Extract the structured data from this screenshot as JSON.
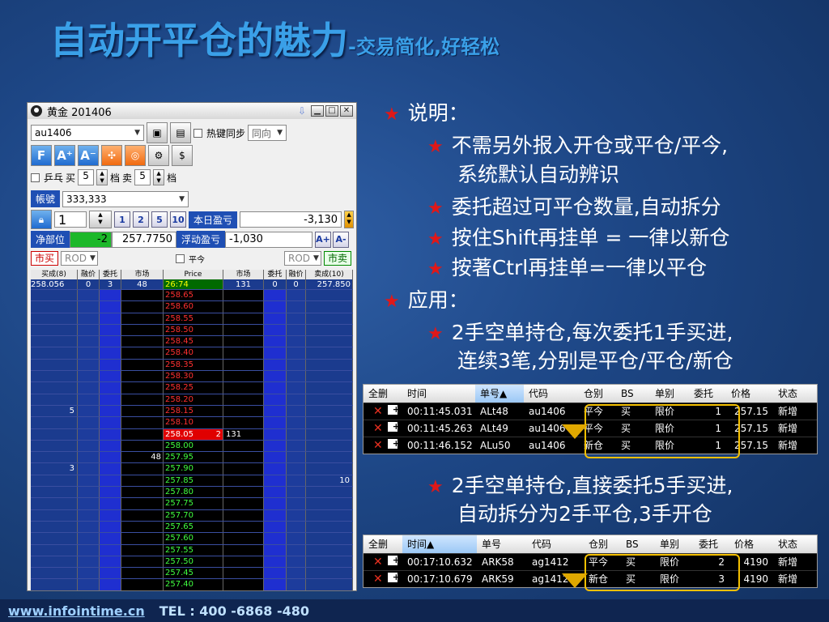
{
  "slide": {
    "title": "自动开平仓的魅力",
    "subtitle": "-交易简化,好轻松"
  },
  "window": {
    "title": "黄金 201406",
    "symbol": "au1406",
    "hotkey_sync_label": "热键同步",
    "direction": "同向",
    "icons": [
      "F",
      "A⁺",
      "A⁻"
    ],
    "pingpong_label": "乒乓",
    "buy_label": "买",
    "buy_ticks": "5",
    "tick_label": "档",
    "sell_label": "卖",
    "sell_ticks": "5",
    "tick_label2": "档",
    "account_label": "帳號",
    "account_value": "333,333",
    "qty": "1",
    "qty_buttons": [
      "1",
      "2",
      "5",
      "10"
    ],
    "today_pnl_label": "本日盈亏",
    "today_pnl_value": "-3,130",
    "net_position_label": "净部位",
    "net_position_value": "-2",
    "avg_price": "257.7750",
    "float_pnl_label": "浮动盈亏",
    "float_pnl_value": "-1,030",
    "font_plus": "A+",
    "font_minus": "A-",
    "market_buy": "市买",
    "rod_left": "ROD",
    "close_today_label": "平今",
    "rod_right": "ROD",
    "market_sell": "市卖"
  },
  "ladder": {
    "headers": [
      "买成(8)",
      "融价",
      "委托",
      "市场",
      "Price",
      "市场",
      "委托",
      "融价",
      "卖成(10)"
    ],
    "first_row": [
      "258.056",
      "0",
      "3",
      "48",
      "26:74",
      "131",
      "0",
      "0",
      "257.850"
    ],
    "rows": [
      {
        "l": "",
        "p": "258.65",
        "r": "",
        "cls": "up"
      },
      {
        "l": "",
        "p": "258.60",
        "r": "",
        "cls": "up"
      },
      {
        "l": "",
        "p": "258.55",
        "r": "",
        "cls": "up"
      },
      {
        "l": "",
        "p": "258.50",
        "r": "",
        "cls": "up"
      },
      {
        "l": "",
        "p": "258.45",
        "r": "",
        "cls": "up"
      },
      {
        "l": "",
        "p": "258.40",
        "r": "",
        "cls": "up"
      },
      {
        "l": "",
        "p": "258.35",
        "r": "",
        "cls": "up"
      },
      {
        "l": "",
        "p": "258.30",
        "r": "",
        "cls": "up"
      },
      {
        "l": "",
        "p": "258.25",
        "r": "",
        "cls": "up"
      },
      {
        "l": "",
        "p": "258.20",
        "r": "",
        "cls": "up"
      },
      {
        "l": "5",
        "p": "258.15",
        "r": "",
        "cls": "up"
      },
      {
        "l": "",
        "p": "258.10",
        "r": "",
        "cls": "up"
      },
      {
        "l": "",
        "p": "258.05",
        "pq": "2",
        "r": "131",
        "cls": "cur"
      },
      {
        "l": "",
        "p": "258.00",
        "r": "",
        "cls": "dn"
      },
      {
        "l": "",
        "m": "48",
        "p": "257.95",
        "r": "",
        "cls": "dn"
      },
      {
        "l": "3",
        "p": "257.90",
        "r": "",
        "cls": "dn"
      },
      {
        "l": "",
        "p": "257.85",
        "r": "",
        "rr": "10",
        "cls": "dn"
      },
      {
        "l": "",
        "p": "257.80",
        "r": "",
        "cls": "dn"
      },
      {
        "l": "",
        "p": "257.75",
        "r": "",
        "cls": "dn"
      },
      {
        "l": "",
        "p": "257.70",
        "r": "",
        "cls": "dn"
      },
      {
        "l": "",
        "p": "257.65",
        "r": "",
        "cls": "dn"
      },
      {
        "l": "",
        "p": "257.60",
        "r": "",
        "cls": "dn"
      },
      {
        "l": "",
        "p": "257.55",
        "r": "",
        "cls": "dn"
      },
      {
        "l": "",
        "p": "257.50",
        "r": "",
        "cls": "dn"
      },
      {
        "l": "",
        "p": "257.45",
        "r": "",
        "cls": "dn"
      },
      {
        "l": "",
        "p": "257.40",
        "r": "",
        "cls": "dn"
      }
    ]
  },
  "bullets": {
    "h1": "说明：",
    "b1": "不需另外报入开仓或平仓/平今,",
    "b1b": "系统默认自动辨识",
    "b2": "委托超过可平仓数量,自动拆分",
    "b3": "按住Shift再挂单 = 一律以新仓",
    "b4": "按著Ctrl再挂单=一律以平仓",
    "h2": "应用：",
    "b5": "2手空单持仓,每次委托1手买进,",
    "b5b": "连续3笔,分别是平仓/平仓/新仓",
    "b6": "2手空单持仓,直接委托5手买进,",
    "b6b": "自动拆分为2手平仓,3手开仓"
  },
  "table1": {
    "headers": [
      "全删",
      "时间",
      "单号▲",
      "代码",
      "仓别",
      "BS",
      "单别",
      "委托",
      "价格",
      "状态"
    ],
    "rows": [
      {
        "time": "00:11:45.031",
        "id": "ALt48",
        "code": "au1406",
        "pos": "平今",
        "bs": "买",
        "type": "限价",
        "qty": "1",
        "price": "257.15",
        "status": "新增"
      },
      {
        "time": "00:11:45.263",
        "id": "ALt49",
        "code": "au1406",
        "pos": "平今",
        "bs": "买",
        "type": "限价",
        "qty": "1",
        "price": "257.15",
        "status": "新增"
      },
      {
        "time": "00:11:46.152",
        "id": "ALu50",
        "code": "au1406",
        "pos": "新仓",
        "bs": "买",
        "type": "限价",
        "qty": "1",
        "price": "257.15",
        "status": "新增"
      }
    ]
  },
  "table2": {
    "headers": [
      "全删",
      "时间▲",
      "单号",
      "代码",
      "仓别",
      "BS",
      "单别",
      "委托",
      "价格",
      "状态"
    ],
    "rows": [
      {
        "time": "00:17:10.632",
        "id": "ARK58",
        "code": "ag1412",
        "pos": "平今",
        "bs": "买",
        "type": "限价",
        "qty": "2",
        "price": "4190",
        "status": "新增"
      },
      {
        "time": "00:17:10.679",
        "id": "ARK59",
        "code": "ag1412",
        "pos": "新仓",
        "bs": "买",
        "type": "限价",
        "qty": "3",
        "price": "4190",
        "status": "新增"
      }
    ]
  },
  "footer": {
    "url": "www.infointime.cn",
    "tel": "TEL : 400 -6868 -480"
  }
}
